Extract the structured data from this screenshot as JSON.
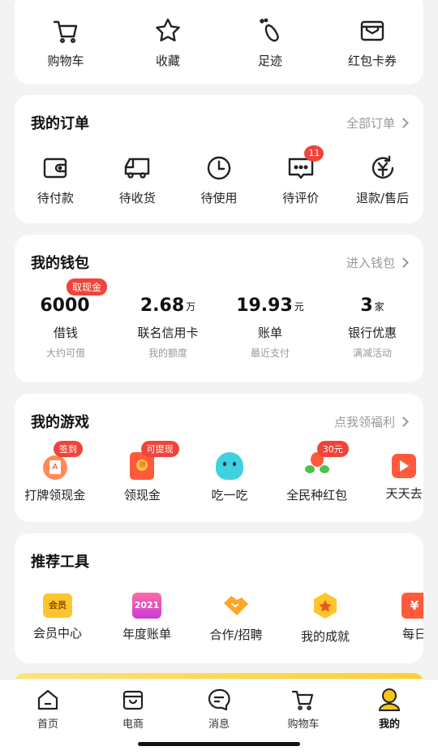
{
  "quick": [
    {
      "label": "购物车",
      "icon": "cart-icon"
    },
    {
      "label": "收藏",
      "icon": "star-icon"
    },
    {
      "label": "足迹",
      "icon": "footprint-icon"
    },
    {
      "label": "红包卡券",
      "icon": "coupon-icon"
    }
  ],
  "orders": {
    "title": "我的订单",
    "more": "全部订单",
    "items": [
      {
        "label": "待付款",
        "icon": "wallet-icon"
      },
      {
        "label": "待收货",
        "icon": "truck-icon"
      },
      {
        "label": "待使用",
        "icon": "clock-icon"
      },
      {
        "label": "待评价",
        "icon": "comment-icon",
        "badge": "11"
      },
      {
        "label": "退款/售后",
        "icon": "refund-icon"
      }
    ]
  },
  "wallet": {
    "title": "我的钱包",
    "more": "进入钱包",
    "items": [
      {
        "value": "6000",
        "unit": "",
        "label": "借钱",
        "sub": "大约可借",
        "badge": "取现金"
      },
      {
        "value": "2.68",
        "unit": "万",
        "label": "联名信用卡",
        "sub": "我的额度"
      },
      {
        "value": "19.93",
        "unit": "元",
        "label": "账单",
        "sub": "最近支付"
      },
      {
        "value": "3",
        "unit": "家",
        "label": "银行优惠",
        "sub": "满减活动"
      }
    ]
  },
  "games": {
    "title": "我的游戏",
    "more": "点我领福利",
    "items": [
      {
        "label": "打牌领现金",
        "badge": "签到"
      },
      {
        "label": "领现金",
        "badge": "可提现"
      },
      {
        "label": "吃一吃",
        "badge": ""
      },
      {
        "label": "全民种红包",
        "badge": "30元"
      },
      {
        "label": "天天去",
        "badge": ""
      }
    ]
  },
  "tools": {
    "title": "推荐工具",
    "items": [
      {
        "label": "会员中心",
        "icon_text": "会员"
      },
      {
        "label": "年度账单",
        "icon_text": "2021"
      },
      {
        "label": "合作/招聘",
        "icon_text": ""
      },
      {
        "label": "我的成就",
        "icon_text": ""
      },
      {
        "label": "每日",
        "icon_text": "¥"
      }
    ]
  },
  "tabs": [
    {
      "label": "首页",
      "icon": "home-icon"
    },
    {
      "label": "电商",
      "icon": "shop-icon"
    },
    {
      "label": "消息",
      "icon": "message-icon"
    },
    {
      "label": "购物车",
      "icon": "cart-icon"
    },
    {
      "label": "我的",
      "icon": "profile-icon",
      "active": true
    }
  ],
  "colors": {
    "accent": "#f5c518",
    "badge": "#f0443a"
  }
}
